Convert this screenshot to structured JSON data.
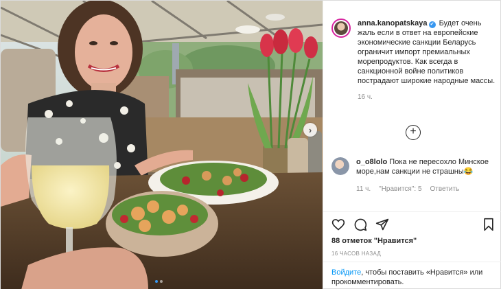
{
  "post": {
    "author": "anna.kanopatskaya",
    "caption": "Будет очень жаль если в ответ на европейские экономические санкции Беларусь ограничит импорт премиальных морепродуктов. Как всегда в санкционной войне политиков пострадают широкие народные массы.",
    "caption_time": "16 ч.",
    "verified_icon": "✔"
  },
  "load_more_icon": "+",
  "comment": {
    "author": "o_o8lolo",
    "text": "Пока не пересохло Минское море,нам санкции не страшны😂",
    "time": "11 ч.",
    "likes": "\"Нравится\": 5",
    "reply": "Ответить"
  },
  "likes_count": "88 отметок \"Нравится\"",
  "posted_ago": "16 ЧАСОВ НАЗАД",
  "login_prompt": {
    "link": "Войдите",
    "rest": ", чтобы поставить «Нравится» или прокомментировать."
  },
  "carousel": {
    "next_icon": "›",
    "count": 2,
    "active_index": 0
  },
  "colors": {
    "link_blue": "#0095f6",
    "dot_active": "#3897f0",
    "muted_text": "#8e8e8e"
  }
}
